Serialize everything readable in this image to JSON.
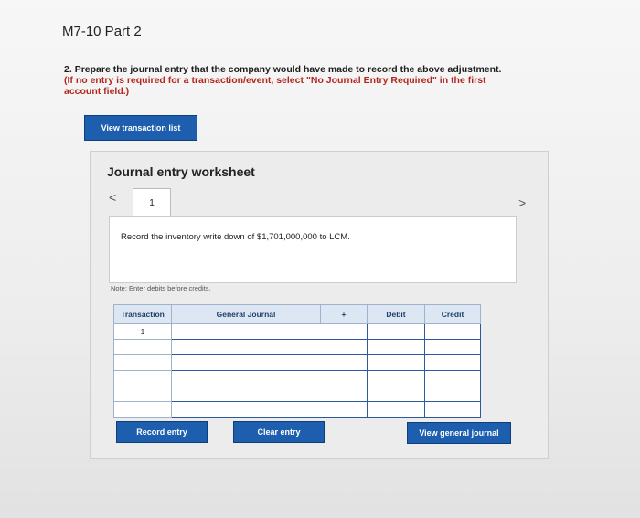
{
  "header": {
    "title": "M7-10 Part 2"
  },
  "question": {
    "number": "2.",
    "text": "Prepare the journal entry that the company would have made to record the above adjustment.",
    "instruction": "(If no entry is required for a transaction/event, select \"No Journal Entry Required\" in the first account field.)"
  },
  "buttons": {
    "view_transaction_list": "View transaction list",
    "record_entry": "Record entry",
    "clear_entry": "Clear entry",
    "view_general_journal": "View general journal"
  },
  "worksheet": {
    "title": "Journal entry worksheet",
    "prev": "<",
    "next": ">",
    "current_tab": "1",
    "description": "Record the inventory write down of $1,701,000,000 to LCM.",
    "note": "Note: Enter debits before credits.",
    "table": {
      "headers": [
        "Transaction",
        "General Journal",
        "+",
        "Debit",
        "Credit"
      ],
      "rows": [
        [
          "1",
          "",
          "",
          ""
        ],
        [
          "",
          "",
          "",
          ""
        ],
        [
          "",
          "",
          "",
          ""
        ],
        [
          "",
          "",
          "",
          ""
        ],
        [
          "",
          "",
          "",
          ""
        ],
        [
          "",
          "",
          "",
          ""
        ]
      ]
    }
  }
}
